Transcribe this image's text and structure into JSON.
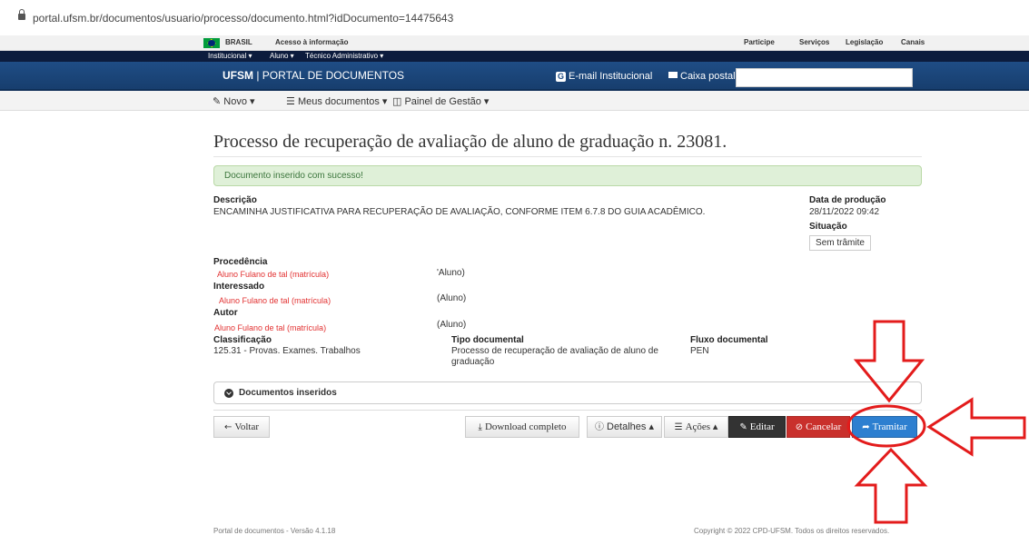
{
  "browser": {
    "url": "portal.ufsm.br/documentos/usuario/processo/documento.html?idDocumento=14475643"
  },
  "govbar": {
    "brasil": "BRASIL",
    "acesso": "Acesso à informação",
    "links": [
      "Participe",
      "Serviços",
      "Legislação",
      "Canais"
    ]
  },
  "subnav": {
    "items": [
      "Institucional ▾",
      "Aluno ▾",
      "Técnico Administrativo ▾"
    ]
  },
  "header": {
    "brand_bold": "UFSM",
    "brand_rest": " | PORTAL DE DOCUMENTOS",
    "email_icon": "G",
    "email": "E-mail Institucional",
    "caixa": "Caixa postal",
    "search_placeholder": ""
  },
  "menu": {
    "novo": "Novo ▾",
    "meus": "Meus documentos ▾",
    "painel": "Painel de Gestão ▾"
  },
  "page": {
    "title": "Processo de recuperação de avaliação de aluno de graduação n. 23081.",
    "alert": "Documento inserido com sucesso!"
  },
  "doc": {
    "descricao_label": "Descrição",
    "descricao": "ENCAMINHA JUSTIFICATIVA PARA RECUPERAÇÃO DE AVALIAÇÃO, CONFORME ITEM 6.7.8 DO GUIA ACADÊMICO.",
    "data_label": "Data de produção",
    "data": "28/11/2022 09:42",
    "situacao_label": "Situação",
    "situacao": "Sem trâmite",
    "procedencia_label": "Procedência",
    "procedencia_nome": "Aluno Fulano de tal (matrícula)",
    "procedencia_tipo": "'Aluno)",
    "interessado_label": "Interessado",
    "interessado_nome": "Aluno Fulano de tal (matrícula)",
    "interessado_tipo": "(Aluno)",
    "autor_label": "Autor",
    "autor_nome": "Aluno Fulano de tal (matrícula)",
    "autor_tipo": "(Aluno)",
    "classificacao_label": "Classificação",
    "classificacao": "125.31 - Provas. Exames. Trabalhos",
    "tipo_label": "Tipo documental",
    "tipo_line1": "Processo de recuperação de avaliação de aluno de",
    "tipo_line2": "graduação",
    "fluxo_label": "Fluxo documental",
    "fluxo": "PEN"
  },
  "panel": {
    "label": "Documentos inseridos"
  },
  "buttons": {
    "voltar": "Voltar",
    "download": "Download completo",
    "detalhes": "Detalhes ▴",
    "acoes": "Ações ▴",
    "editar": "Editar",
    "cancelar": "Cancelar",
    "tramitar": "Tramitar"
  },
  "footer": {
    "left": "Portal de documentos - Versão 4.1.18",
    "right": "Copyright © 2022 CPD-UFSM. Todos os direitos reservados."
  },
  "colors": {
    "header_blue": "#1f4d85",
    "annotation_red": "#e31b1b",
    "primary": "#2d7fd0",
    "danger": "#c9302c"
  }
}
